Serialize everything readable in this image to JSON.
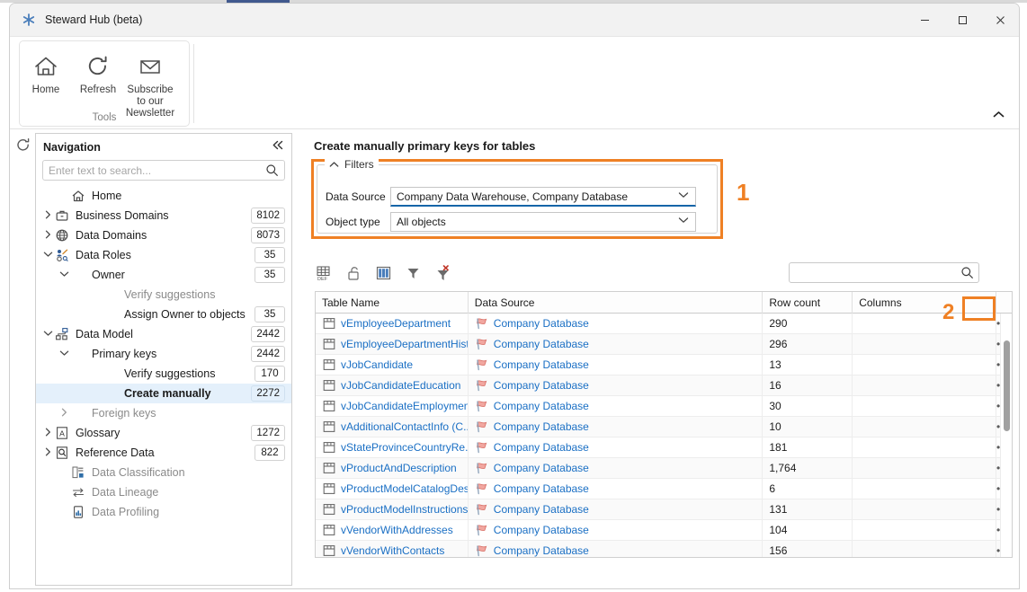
{
  "window": {
    "title": "Steward Hub (beta)",
    "app_icon": "asterisk-icon",
    "minimize_label": "Minimize",
    "maximize_label": "Maximize",
    "close_label": "Close"
  },
  "ribbon": {
    "group_title": "Tools",
    "items": [
      {
        "label": "Home",
        "icon": "home-icon"
      },
      {
        "label": "Refresh",
        "icon": "refresh-icon"
      },
      {
        "label": "Subscribe to our Newsletter",
        "icon": "envelope-icon"
      }
    ],
    "collapse_icon": "chevron-up-icon"
  },
  "rail": {
    "refresh_icon": "refresh-icon"
  },
  "navigation": {
    "title": "Navigation",
    "collapse_icon": "double-chevron-left-icon",
    "search": {
      "value": "",
      "placeholder": "Enter text to search...",
      "icon": "search-icon"
    },
    "items": [
      {
        "label": "Home",
        "icon": "home-icon",
        "indent": 1,
        "chevron": "",
        "badge": "",
        "dim": false,
        "selected": false
      },
      {
        "label": "Business Domains",
        "icon": "briefcase-icon",
        "indent": 0,
        "chevron": "right",
        "badge": "8102",
        "dim": false,
        "selected": false
      },
      {
        "label": "Data Domains",
        "icon": "globe-icon",
        "indent": 0,
        "chevron": "right",
        "badge": "8073",
        "dim": false,
        "selected": false
      },
      {
        "label": "Data Roles",
        "icon": "user-role-icon",
        "indent": 0,
        "chevron": "down",
        "badge": "35",
        "dim": false,
        "selected": false
      },
      {
        "label": "Owner",
        "icon": "",
        "indent": 1,
        "chevron": "down",
        "badge": "35",
        "dim": false,
        "selected": false
      },
      {
        "label": "Verify suggestions",
        "icon": "",
        "indent": 3,
        "chevron": "",
        "badge": "",
        "dim": true,
        "selected": false
      },
      {
        "label": "Assign Owner to objects",
        "icon": "",
        "indent": 3,
        "chevron": "",
        "badge": "35",
        "dim": false,
        "selected": false
      },
      {
        "label": "Data Model",
        "icon": "model-icon",
        "indent": 0,
        "chevron": "down",
        "badge": "2442",
        "dim": false,
        "selected": false
      },
      {
        "label": "Primary keys",
        "icon": "",
        "indent": 1,
        "chevron": "down",
        "badge": "2442",
        "dim": false,
        "selected": false
      },
      {
        "label": "Verify suggestions",
        "icon": "",
        "indent": 3,
        "chevron": "",
        "badge": "170",
        "dim": false,
        "selected": false
      },
      {
        "label": "Create manually",
        "icon": "",
        "indent": 3,
        "chevron": "",
        "badge": "2272",
        "dim": false,
        "selected": true
      },
      {
        "label": "Foreign keys",
        "icon": "",
        "indent": 1,
        "chevron": "right",
        "badge": "",
        "dim": true,
        "selected": false
      },
      {
        "label": "Glossary",
        "icon": "glossary-icon",
        "indent": 0,
        "chevron": "right",
        "badge": "1272",
        "dim": false,
        "selected": false
      },
      {
        "label": "Reference Data",
        "icon": "reference-data-icon",
        "indent": 0,
        "chevron": "right",
        "badge": "822",
        "dim": false,
        "selected": false
      },
      {
        "label": "Data Classification",
        "icon": "classification-icon",
        "indent": 1,
        "chevron": "",
        "badge": "",
        "dim": true,
        "selected": false
      },
      {
        "label": "Data Lineage",
        "icon": "lineage-icon",
        "indent": 1,
        "chevron": "",
        "badge": "",
        "dim": true,
        "selected": false
      },
      {
        "label": "Data Profiling",
        "icon": "profiling-icon",
        "indent": 1,
        "chevron": "",
        "badge": "",
        "dim": true,
        "selected": false
      }
    ]
  },
  "content": {
    "page_title": "Create manually primary keys for tables",
    "filters": {
      "legend": "Filters",
      "collapse_icon": "chevron-up-icon",
      "fields": [
        {
          "label": "Data Source",
          "value": "Company Data Warehouse, Company Database",
          "caret": "chevron-down-icon",
          "active": true
        },
        {
          "label": "Object type",
          "value": "All objects",
          "caret": "chevron-down-icon",
          "active": false
        }
      ],
      "marker": "1"
    },
    "grid_toolbar": {
      "icons": [
        {
          "name": "table-definition-icon",
          "active": false
        },
        {
          "name": "lock-open-icon",
          "active": false
        },
        {
          "name": "choose-columns-icon",
          "active": true
        },
        {
          "name": "filter-icon",
          "active": false
        },
        {
          "name": "clear-filter-icon",
          "active": false
        }
      ],
      "search": {
        "value": "",
        "placeholder": "",
        "icon": "search-icon"
      }
    },
    "grid": {
      "columns": [
        "Table Name",
        "Data Source",
        "Row count",
        "Columns"
      ],
      "row_action_icon": "ellipsis-icon",
      "row_icon": "table-icon",
      "source_icon": "data-source-icon",
      "marker": "2",
      "rows": [
        {
          "name": "vEmployeeDepartment",
          "source": "Company Database",
          "rows": "290",
          "columns": ""
        },
        {
          "name": "vEmployeeDepartmentHist...",
          "source": "Company Database",
          "rows": "296",
          "columns": ""
        },
        {
          "name": "vJobCandidate",
          "source": "Company Database",
          "rows": "13",
          "columns": ""
        },
        {
          "name": "vJobCandidateEducation",
          "source": "Company Database",
          "rows": "16",
          "columns": ""
        },
        {
          "name": "vJobCandidateEmployment",
          "source": "Company Database",
          "rows": "30",
          "columns": ""
        },
        {
          "name": "vAdditionalContactInfo (C...",
          "source": "Company Database",
          "rows": "10",
          "columns": ""
        },
        {
          "name": "vStateProvinceCountryRe...",
          "source": "Company Database",
          "rows": "181",
          "columns": ""
        },
        {
          "name": "vProductAndDescription",
          "source": "Company Database",
          "rows": "1,764",
          "columns": ""
        },
        {
          "name": "vProductModelCatalogDes...",
          "source": "Company Database",
          "rows": "6",
          "columns": ""
        },
        {
          "name": "vProductModelInstructions",
          "source": "Company Database",
          "rows": "131",
          "columns": ""
        },
        {
          "name": "vVendorWithAddresses",
          "source": "Company Database",
          "rows": "104",
          "columns": ""
        },
        {
          "name": "vVendorWithContacts",
          "source": "Company Database",
          "rows": "156",
          "columns": ""
        }
      ]
    }
  },
  "colors": {
    "accent_orange": "#ef8024",
    "link_blue": "#1a6fc4",
    "selection_blue": "#e4f0fb",
    "active_underline": "#1565a8"
  }
}
